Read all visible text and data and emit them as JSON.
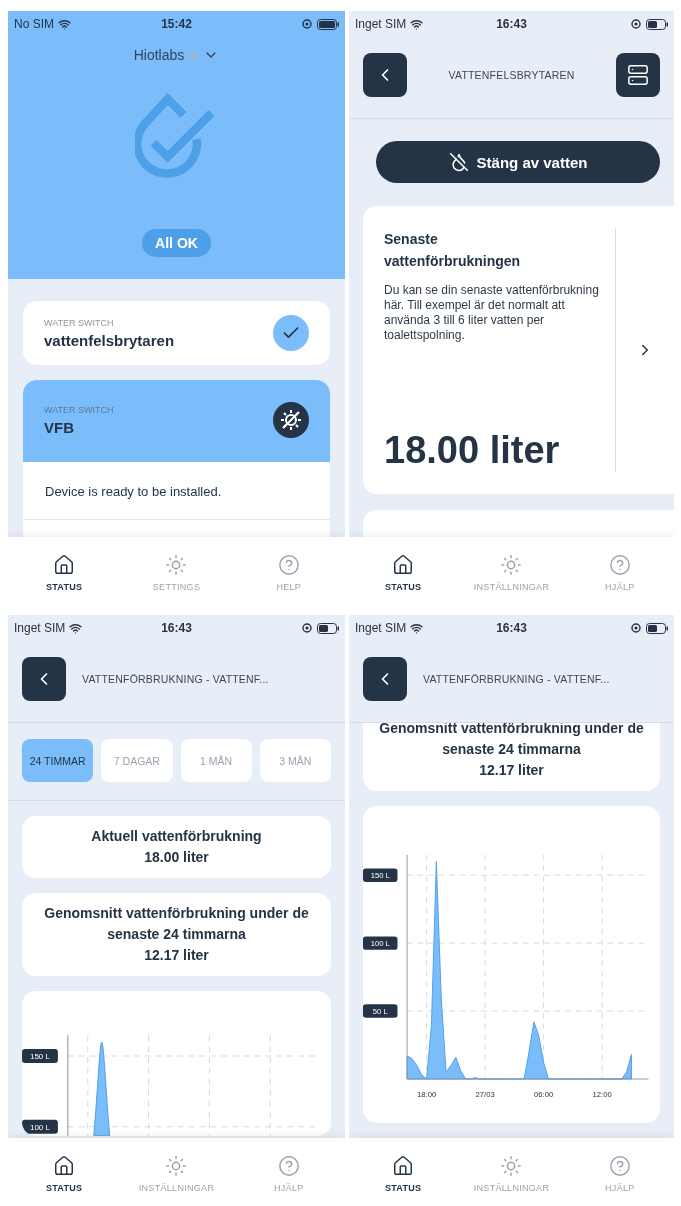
{
  "screens": [
    {
      "kind": "home",
      "status_bar": {
        "carrier": "No SIM",
        "time": "15:42"
      },
      "account": {
        "name": "Hiotlabs"
      },
      "hero": {
        "badge": "All OK"
      },
      "devices": [
        {
          "kind": "ok",
          "type_label": "WATER SWITCH",
          "name": "vattenfelsbrytaren"
        },
        {
          "kind": "setup",
          "type_label": "WATER SWITCH",
          "name": "VFB",
          "message": "Device is ready to be installed."
        }
      ],
      "tab_bar": [
        {
          "label": "STATUS",
          "selected": true
        },
        {
          "label": "SETTINGS",
          "selected": false
        },
        {
          "label": "HELP",
          "selected": false
        }
      ]
    },
    {
      "kind": "device",
      "status_bar": {
        "carrier": "Inget SIM",
        "time": "16:43"
      },
      "header": {
        "title": "VATTENFELSBRYTAREN"
      },
      "action_button": "Stäng av vatten",
      "usage_card": {
        "title": "Senaste vattenförbrukningen",
        "description": "Du kan se din senaste vattenförbrukning här. Till exempel är det normalt att använda 3 till 6 liter vatten per toalettspolning.",
        "value": "18.00 liter"
      },
      "tab_bar": [
        {
          "label": "STATUS",
          "selected": true
        },
        {
          "label": "INSTÄLLNINGAR",
          "selected": false
        },
        {
          "label": "HJÄLP",
          "selected": false
        }
      ]
    },
    {
      "kind": "usage",
      "status_bar": {
        "carrier": "Inget SIM",
        "time": "16:43"
      },
      "header": {
        "title": "VATTENFÖRBRUKNING - VATTENF..."
      },
      "ranges": [
        {
          "label": "24 TIMMAR",
          "selected": true
        },
        {
          "label": "7 DAGAR",
          "selected": false
        },
        {
          "label": "1 MÅN",
          "selected": false
        },
        {
          "label": "3 MÅN",
          "selected": false
        }
      ],
      "stats": [
        {
          "title": "Aktuell vattenförbrukning",
          "value": "18.00 liter"
        },
        {
          "title": "Genomsnitt vattenförbrukning under de senaste 24 timmarna",
          "value": "12.17 liter"
        }
      ],
      "chart_preview": {
        "y_labels": [
          "150 L",
          "100 L"
        ]
      },
      "tab_bar": [
        {
          "label": "STATUS",
          "selected": true
        },
        {
          "label": "INSTÄLLNINGAR",
          "selected": false
        },
        {
          "label": "HJÄLP",
          "selected": false
        }
      ]
    },
    {
      "kind": "usage",
      "status_bar": {
        "carrier": "Inget SIM",
        "time": "16:43"
      },
      "header": {
        "title": "VATTENFÖRBRUKNING - VATTENF..."
      },
      "stats": [
        {
          "title": "Genomsnitt vattenförbrukning under de senaste 24 timmarna",
          "value": "12.17 liter"
        }
      ],
      "chart_data": {
        "type": "area",
        "categories": [
          null,
          null,
          null,
          null,
          "18:00",
          null,
          null,
          null,
          null,
          null,
          null,
          null,
          null,
          null,
          null,
          null,
          "27/03",
          null,
          null,
          null,
          null,
          null,
          null,
          null,
          null,
          null,
          null,
          null,
          "06:00",
          null,
          null,
          null,
          null,
          null,
          null,
          null,
          null,
          null,
          null,
          null,
          "12:00",
          null,
          null,
          null,
          null,
          null,
          null,
          null,
          null,
          null
        ],
        "series": [
          {
            "color": "#7bbdfb",
            "values": [
              17,
              15,
              10,
              3,
              0,
              40,
              160,
              60,
              5,
              10,
              16,
              6,
              0,
              0,
              1,
              0,
              0,
              0,
              0,
              0,
              0,
              0,
              0,
              0,
              0,
              20,
              42,
              32,
              12,
              0,
              0,
              0,
              0,
              0,
              0,
              0,
              0,
              0,
              0,
              0,
              0,
              0,
              0,
              0,
              0,
              5,
              18,
              null,
              null,
              null
            ]
          }
        ],
        "ylim": [
          0,
          165
        ],
        "grid": true,
        "yticks": [
          {
            "value": 50,
            "label": "50 L"
          },
          {
            "value": 100,
            "label": "100 L"
          },
          {
            "value": 150,
            "label": "150 L"
          }
        ]
      },
      "tab_bar": [
        {
          "label": "STATUS",
          "selected": true
        },
        {
          "label": "INSTÄLLNINGAR",
          "selected": false
        },
        {
          "label": "HJÄLP",
          "selected": false
        }
      ]
    }
  ]
}
